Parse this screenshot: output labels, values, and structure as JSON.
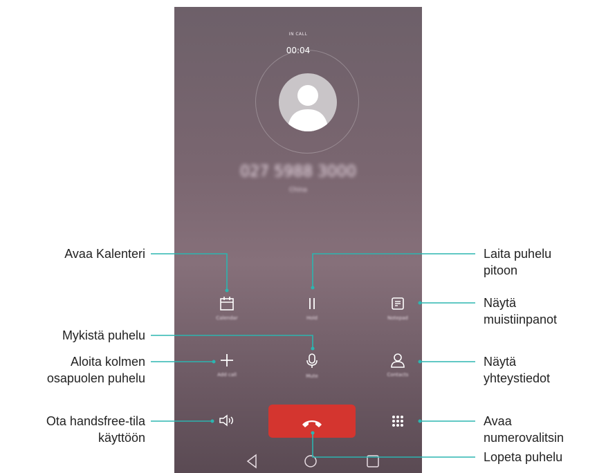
{
  "call": {
    "status": "IN CALL",
    "timer": "00:04",
    "number": "027 5988 3000",
    "location": "China"
  },
  "controls": {
    "calendar": "Calendar",
    "hold": "Hold",
    "notepad": "Notepad",
    "mute": "Mute",
    "add_call": "Add call",
    "contacts": "Contacts"
  },
  "callouts": {
    "open_calendar": "Avaa Kalenteri",
    "hold_line1": "Laita puhelu",
    "hold_line2": "pitoon",
    "notes_line1": "Näytä",
    "notes_line2": "muistiinpanot",
    "mute": "Mykistä puhelu",
    "add_line1": "Aloita kolmen",
    "add_line2": "osapuolen puhelu",
    "contacts_line1": "Näytä",
    "contacts_line2": "yhteystiedot",
    "speaker_line1": "Ota handsfree-tila",
    "speaker_line2": "käyttöön",
    "dialpad_line1": "Avaa",
    "dialpad_line2": "numerovalitsin",
    "end_call": "Lopeta puhelu"
  },
  "colors": {
    "accent_line": "#2cb5b0",
    "end_button": "#d4352f",
    "background_phone": "#7a6670"
  }
}
